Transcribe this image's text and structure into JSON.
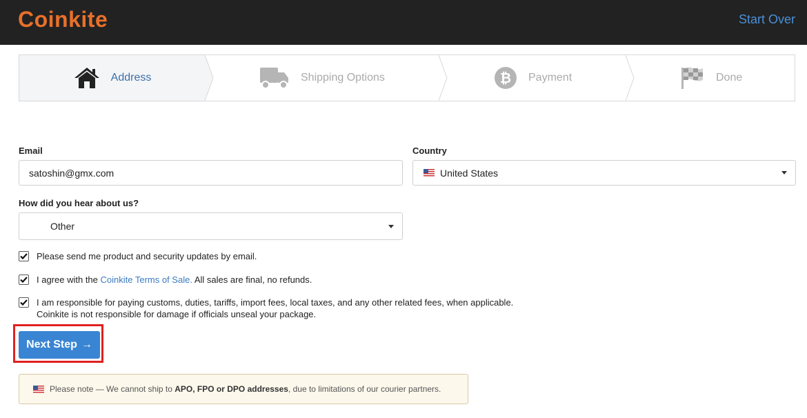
{
  "header": {
    "logo": "Coinkite",
    "start_over": "Start Over"
  },
  "steps": [
    {
      "label": "Address",
      "icon": "home-icon",
      "active": true
    },
    {
      "label": "Shipping Options",
      "icon": "truck-icon",
      "active": false
    },
    {
      "label": "Payment",
      "icon": "bitcoin-icon",
      "active": false
    },
    {
      "label": "Done",
      "icon": "checkered-flag-icon",
      "active": false
    }
  ],
  "form": {
    "email_label": "Email",
    "email_value": "satoshin@gmx.com",
    "country_label": "Country",
    "country_value": "United States",
    "country_flag": "us-flag-icon",
    "hear_label": "How did you hear about us?",
    "hear_value": "Other"
  },
  "checkboxes": {
    "updates": {
      "text": "Please send me product and security updates by email.",
      "checked": true
    },
    "terms": {
      "prefix": "I agree with the ",
      "link": "Coinkite Terms of Sale.",
      "suffix": " All sales are final, no refunds.",
      "checked": true
    },
    "customs": {
      "line1": "I am responsible for paying customs, duties, tariffs, import fees, local taxes, and any other related fees, when applicable.",
      "line2": "Coinkite is not responsible for damage if officials unseal your package.",
      "checked": true
    }
  },
  "next_button": {
    "label": "Next Step",
    "arrow": "→"
  },
  "note": {
    "prefix": "Please note — We cannot ship to ",
    "bold": "APO, FPO or DPO addresses",
    "suffix": ", due to limitations of our courier partners."
  },
  "colors": {
    "brand": "#e8702a",
    "link": "#4a90d9",
    "button": "#3a85d3",
    "highlight": "#e02020"
  }
}
